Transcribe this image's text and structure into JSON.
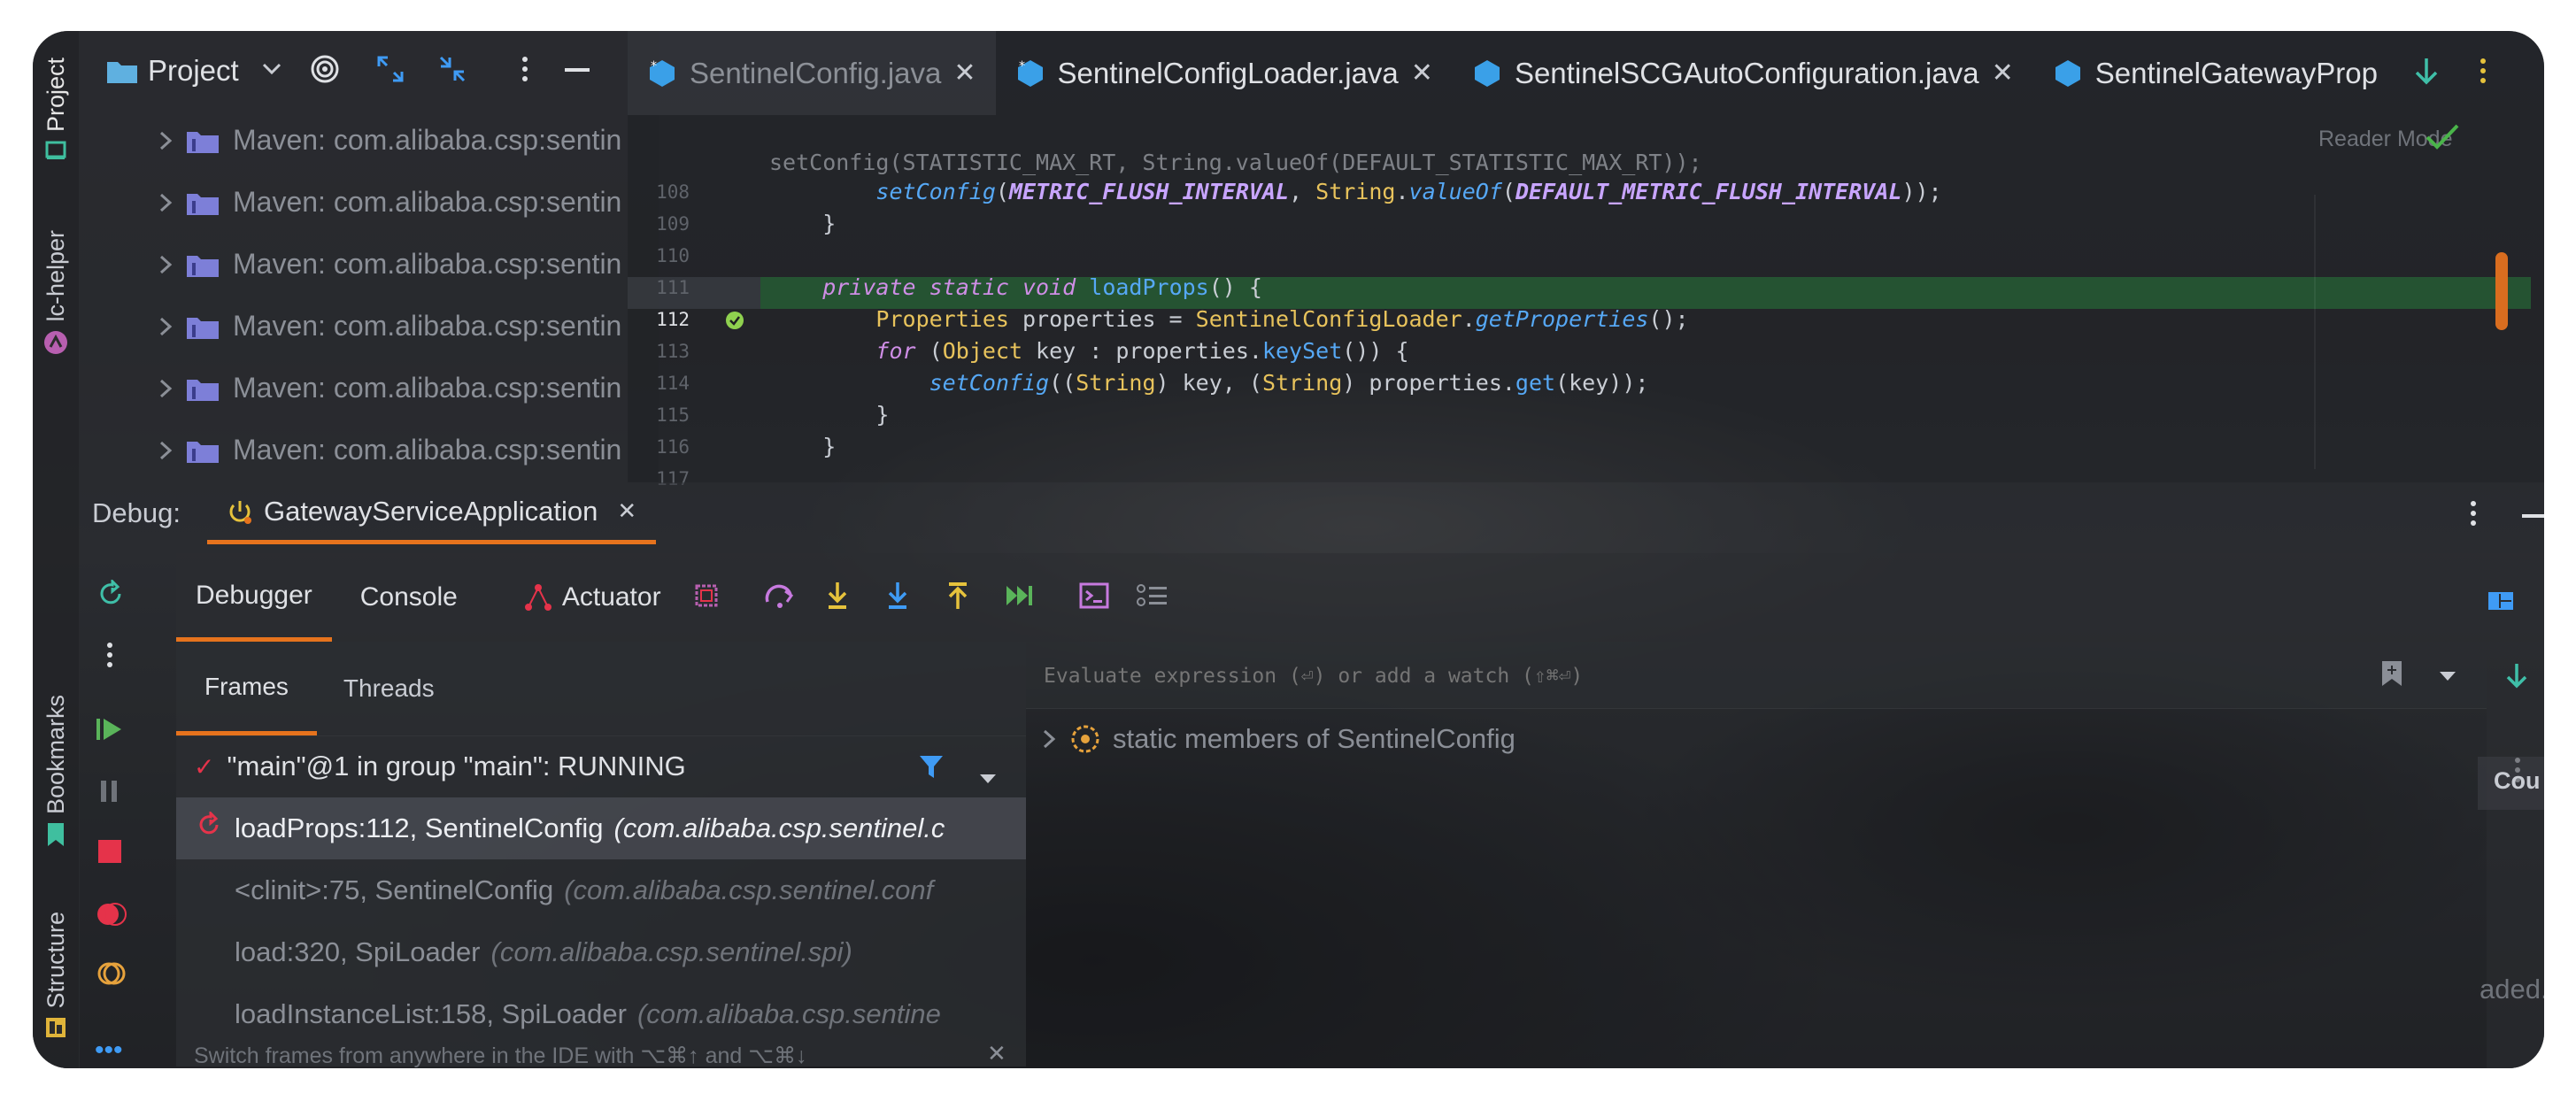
{
  "left_strip": {
    "project_label": "Project",
    "lc_helper_label": "lc-helper",
    "bookmarks_label": "Bookmarks",
    "structure_label": "Structure"
  },
  "project_panel": {
    "title": "Project",
    "items": [
      {
        "label": "Maven: com.alibaba.csp:sentin"
      },
      {
        "label": "Maven: com.alibaba.csp:sentin"
      },
      {
        "label": "Maven: com.alibaba.csp:sentin"
      },
      {
        "label": "Maven: com.alibaba.csp:sentin"
      },
      {
        "label": "Maven: com.alibaba.csp:sentin"
      },
      {
        "label": "Maven: com.alibaba.csp:sentin"
      }
    ]
  },
  "editor": {
    "tabs": [
      {
        "label": "SentinelConfig.java",
        "active": true
      },
      {
        "label": "SentinelConfigLoader.java",
        "active": false
      },
      {
        "label": "SentinelSCGAutoConfiguration.java",
        "active": false
      },
      {
        "label": "SentinelGatewayProp",
        "active": false
      }
    ],
    "reader_mode": "Reader Mode",
    "lines": [
      {
        "num": "108"
      },
      {
        "num": "109"
      },
      {
        "num": "110"
      },
      {
        "num": "111"
      },
      {
        "num": "112"
      },
      {
        "num": "113"
      },
      {
        "num": "114"
      },
      {
        "num": "115"
      },
      {
        "num": "116"
      },
      {
        "num": "117"
      }
    ],
    "code": {
      "l107_partial": "setConfig(STATISTIC_MAX_RT, String.valueOf(DEFAULT_STATISTIC_MAX_RT));",
      "l108_a": "setConfig",
      "l108_b": "METRIC_FLUSH_INTERVAL",
      "l108_c": "String",
      "l108_d": "valueOf",
      "l108_e": "DEFAULT_METRIC_FLUSH_INTERVAL",
      "l109": "}",
      "l111_a": "private static void",
      "l111_b": "loadProps",
      "l111_c": "() {",
      "l112_a": "Properties",
      "l112_b": " properties = ",
      "l112_c": "SentinelConfigLoader",
      "l112_d": "getProperties",
      "l113_a": "for",
      "l113_b": "Object",
      "l113_c": " key : properties.",
      "l113_d": "keySet",
      "l114_a": "setConfig",
      "l114_b": "String",
      "l114_c": "String",
      "l114_d": "get",
      "l115": "}",
      "l116": "}"
    }
  },
  "debug": {
    "label": "Debug:",
    "session_tab": "GatewayServiceApplication",
    "toolbar": {
      "debugger": "Debugger",
      "console": "Console",
      "actuator": "Actuator"
    },
    "subtabs": {
      "frames": "Frames",
      "threads": "Threads"
    },
    "thread": "\"main\"@1 in group \"main\": RUNNING",
    "frames": [
      {
        "method": "loadProps:112, SentinelConfig",
        "pkg": "(com.alibaba.csp.sentinel.c"
      },
      {
        "method": "<clinit>:75, SentinelConfig",
        "pkg": "(com.alibaba.csp.sentinel.conf"
      },
      {
        "method": "load:320, SpiLoader",
        "pkg": "(com.alibaba.csp.sentinel.spi)"
      },
      {
        "method": "loadInstanceList:158, SpiLoader",
        "pkg": "(com.alibaba.csp.sentine"
      }
    ],
    "hint": "Switch frames from anywhere in the IDE with ⌥⌘↑ and ⌥⌘↓",
    "evaluate_placeholder": "Evaluate expression (⏎) or add a watch (⇧⌘⏎)",
    "static_members": "static members of SentinelConfig",
    "right_partial_cou": "Cou",
    "right_partial_loaded": "aded."
  },
  "colors": {
    "accent_orange": "#e6731d",
    "highlight_green": "#265c34",
    "blue_icon": "#3f9bf5"
  }
}
